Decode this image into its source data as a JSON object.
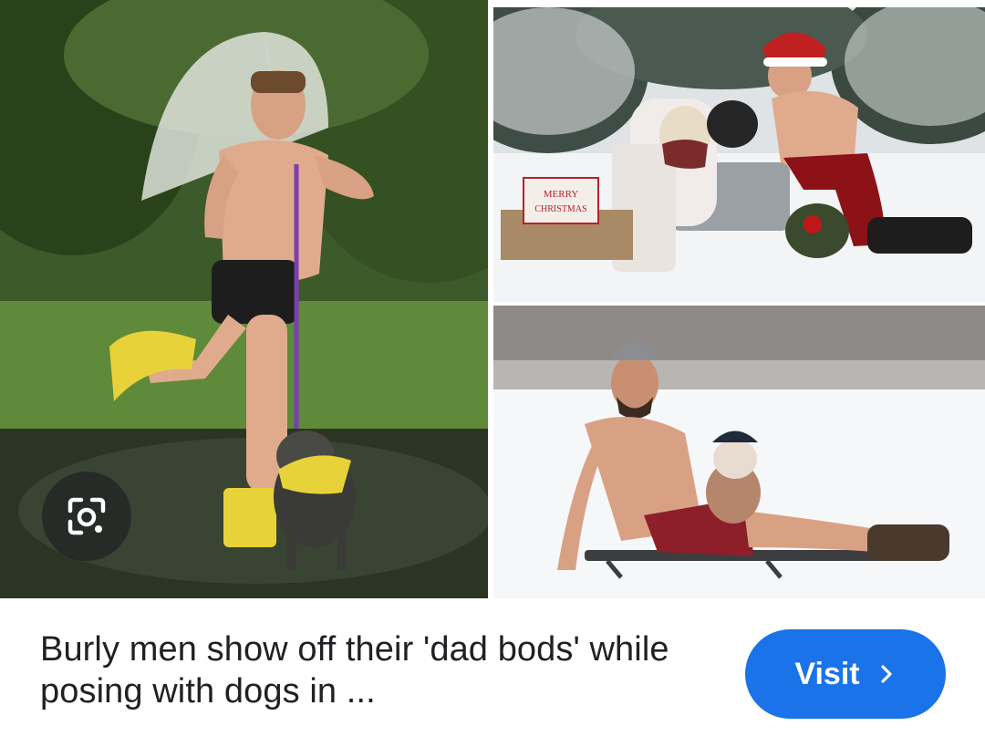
{
  "result": {
    "caption": "Burly men show off their 'dad bods' while posing with dogs in ...",
    "visit_label": "Visit",
    "visit_icon": "chevron-right-icon",
    "lens_icon": "google-lens-icon"
  },
  "images": {
    "left": {
      "kind": "photo",
      "subject": "man-with-umbrella-and-dog-in-rain"
    },
    "top_right": {
      "kind": "photo",
      "subject": "santa-hat-man-with-dogs-in-snow",
      "sign_text_line1": "MERRY",
      "sign_text_line2": "CHRISTMAS"
    },
    "bottom_right": {
      "kind": "photo",
      "subject": "man-on-sled-with-dog-in-snow"
    }
  },
  "colors": {
    "accent": "#1a73e8",
    "caption_text": "#202124",
    "background": "#ffffff"
  }
}
